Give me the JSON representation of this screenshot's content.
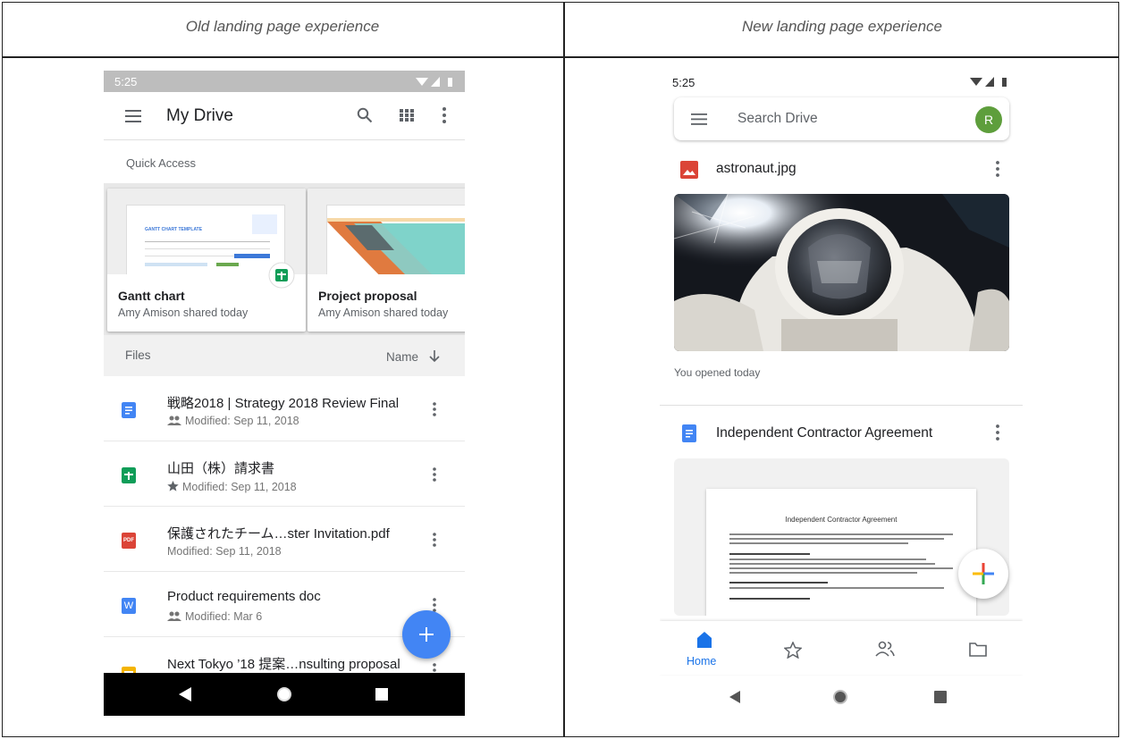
{
  "columns": {
    "old_title": "Old landing page experience",
    "new_title": "New landing page experience"
  },
  "old": {
    "status_time": "5:25",
    "toolbar_title": "My Drive",
    "quick_access_label": "Quick Access",
    "quick_access": [
      {
        "name": "Gantt chart",
        "subtitle": "Amy Amison shared today",
        "thumb_heading": "GANTT CHART TEMPLATE"
      },
      {
        "name": "Project proposal",
        "subtitle": "Amy Amison shared today"
      }
    ],
    "files_label": "Files",
    "sort_label": "Name",
    "files": [
      {
        "title": "戦略2018 | Strategy 2018 Review Final",
        "subtitle": "Modified: Sep 11, 2018",
        "type": "docs",
        "prefix": "shared-icon"
      },
      {
        "title": "山田（株）請求書",
        "subtitle": "Modified: Sep 11, 2018",
        "type": "sheets",
        "prefix": "star-icon"
      },
      {
        "title": "保護されたチーム…ster Invitation.pdf",
        "subtitle": "Modified: Sep 11, 2018",
        "type": "pdf",
        "prefix": ""
      },
      {
        "title": "Product requirements doc",
        "subtitle": "Modified: Mar 6",
        "type": "word",
        "prefix": "shared-icon"
      },
      {
        "title": "Next Tokyo ’18 提案…nsulting proposal",
        "subtitle": "",
        "type": "slides",
        "prefix": ""
      }
    ],
    "pdf_badge": "PDF",
    "word_badge": "W",
    "colors": {
      "docs": "#4285f4",
      "sheets": "#0f9d58",
      "pdf": "#db4437",
      "slides": "#f4b400",
      "fab": "#4285f4"
    }
  },
  "new": {
    "status_time": "5:25",
    "search_placeholder": "Search Drive",
    "avatar_letter": "R",
    "cards": [
      {
        "title": "astronaut.jpg",
        "caption": "You opened today",
        "type": "image"
      },
      {
        "title": "Independent Contractor Agreement",
        "type": "docs",
        "doc_heading": "Independent Contractor Agreement"
      }
    ],
    "bottom_nav": [
      {
        "label": "Home",
        "icon": "home-icon",
        "active": true
      },
      {
        "label": "",
        "icon": "star-icon"
      },
      {
        "label": "",
        "icon": "shared-icon"
      },
      {
        "label": "",
        "icon": "folder-icon"
      }
    ],
    "colors": {
      "accent": "#1a73e8",
      "avatar": "#5e9e3c",
      "image_icon": "#db4437"
    }
  }
}
